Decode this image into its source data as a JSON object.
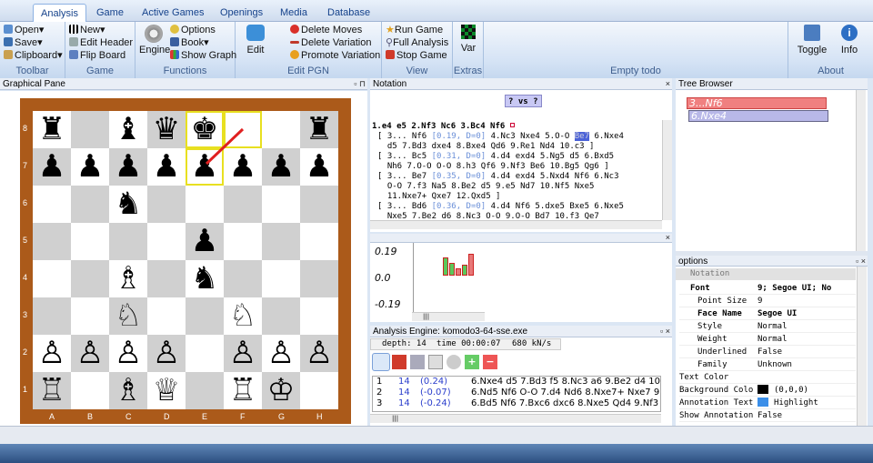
{
  "ribbon": {
    "tabs": [
      "Analysis",
      "Game",
      "Active Games",
      "Openings",
      "Media",
      "Database"
    ],
    "active_tab": "Analysis",
    "toolbar": {
      "open": "Open",
      "save": "Save",
      "clipboard": "Clipboard",
      "label": "Toolbar"
    },
    "game": {
      "new": "New",
      "edit_header": "Edit Header",
      "flip_board": "Flip Board",
      "label": "Game"
    },
    "functions": {
      "engine": "Engine",
      "options": "Options",
      "book": "Book",
      "show_graph": "Show Graph",
      "label": "Functions"
    },
    "edit_pgn": {
      "edit": "Edit",
      "delete_moves": "Delete Moves",
      "delete_variation": "Delete Variation",
      "promote_variation": "Promote Variation",
      "label": "Edit PGN"
    },
    "view": {
      "run_game": "Run Game",
      "full_analysis": "Full Analysis",
      "stop_game": "Stop Game",
      "label": "View"
    },
    "extras": {
      "var": "Var",
      "label": "Extras"
    },
    "empty": {
      "label": "Empty todo"
    },
    "about": {
      "toggle": "Toggle",
      "info": "Info",
      "label": "About"
    }
  },
  "graphical_pane": {
    "title": "Graphical Pane"
  },
  "board": {
    "files": [
      "A",
      "B",
      "C",
      "D",
      "E",
      "F",
      "G",
      "H"
    ],
    "ranks": [
      "8",
      "7",
      "6",
      "5",
      "4",
      "3",
      "2",
      "1"
    ],
    "rows": [
      [
        "♜",
        "",
        "♝",
        "♛",
        "♚",
        "",
        "",
        "♜"
      ],
      [
        "♟",
        "♟",
        "♟",
        "♟",
        "♟",
        "♟",
        "♟",
        "♟"
      ],
      [
        "",
        "",
        "♞",
        "",
        "",
        "",
        "",
        ""
      ],
      [
        "",
        "",
        "",
        "",
        "♟",
        "",
        "",
        ""
      ],
      [
        "",
        "",
        "♗",
        "",
        "♞",
        "",
        "",
        ""
      ],
      [
        "",
        "",
        "♘",
        "",
        "",
        "♘",
        "",
        ""
      ],
      [
        "♙",
        "♙",
        "♙",
        "♙",
        "",
        "♙",
        "♙",
        "♙"
      ],
      [
        "♖",
        "",
        "♗",
        "♕",
        "",
        "♖",
        "♔",
        ""
      ]
    ]
  },
  "notation": {
    "title": "Notation",
    "vs": "? vs ?",
    "main_line": "1.e4 e5 2.Nf3 Nc6 3.Bc4 Nf6",
    "lines": [
      {
        "pre": "[ 3... Nf6 ",
        "eval": "[0.19, D=0]",
        "post": " 4.Nc3 Nxe4 5.O-O ",
        "hl": "Be7",
        "tail": " 6.Nxe4"
      },
      {
        "pre": "  d5 7.Bd3 dxe4 8.Bxe4 Qd6 9.Re1 Nd4 10.c3 ]",
        "eval": "",
        "post": "",
        "hl": "",
        "tail": ""
      },
      {
        "pre": "[ 3... Bc5 ",
        "eval": "[0.31, D=0]",
        "post": " 4.d4 exd4 5.Ng5 d5 6.Bxd5",
        "hl": "",
        "tail": ""
      },
      {
        "pre": "  Nh6 7.O-O O-O 8.h3 Qf6 9.Nf3 Be6 10.Bg5 Qg6 ]",
        "eval": "",
        "post": "",
        "hl": "",
        "tail": ""
      },
      {
        "pre": "[ 3... Be7 ",
        "eval": "[0.35, D=0]",
        "post": " 4.d4 exd4 5.Nxd4 Nf6 6.Nc3",
        "hl": "",
        "tail": ""
      },
      {
        "pre": "  O-O 7.f3 Na5 8.Be2 d5 9.e5 Nd7 10.Nf5 Nxe5",
        "eval": "",
        "post": "",
        "hl": "",
        "tail": ""
      },
      {
        "pre": "  11.Nxe7+ Qxe7 12.Qxd5 ]",
        "eval": "",
        "post": "",
        "hl": "",
        "tail": ""
      },
      {
        "pre": "[ 3... Bd6 ",
        "eval": "[0.36, D=0]",
        "post": " 4.d4 Nf6 5.dxe5 Bxe5 6.Nxe5",
        "hl": "",
        "tail": ""
      },
      {
        "pre": "  Nxe5 7.Be2 d6 8.Nc3 O-O 9.O-O Bd7 10.f3 Qe7",
        "eval": "",
        "post": "",
        "hl": "",
        "tail": ""
      }
    ]
  },
  "graph": {
    "labels": [
      "0.19",
      "0.0",
      "-0.19"
    ]
  },
  "analysis": {
    "title": "Analysis Engine: komodo3-64-sse.exe",
    "depth": "depth:  14",
    "time": "time 00:00:07",
    "speed": "680 kN/s",
    "rows": [
      {
        "n": "1",
        "d": "14",
        "score": "(0.24)",
        "pv": "6.Nxe4 d5 7.Bd3 f5 8.Nc3 a6 9.Be2 d4 10.N"
      },
      {
        "n": "2",
        "d": "14",
        "score": "(-0.07)",
        "pv": "6.Nd5 Nf6 O-O 7.d4 Nd6 8.Nxe7+ Nxe7 9.Nxe5"
      },
      {
        "n": "3",
        "d": "14",
        "score": "(-0.24)",
        "pv": "6.Bd5 Nf6 7.Bxc6 dxc6 8.Nxe5 Qd4 9.Nf3 C"
      }
    ]
  },
  "tree": {
    "title": "Tree Browser",
    "nodes": [
      "3...Nf6",
      "6.Nxe4"
    ]
  },
  "options": {
    "title": "options",
    "section": "Notation",
    "font_key": "Font",
    "font_val": "9; Segoe UI; No",
    "rows": [
      {
        "k": "Point Size",
        "v": "9"
      },
      {
        "k": "Face Name",
        "v": "Segoe UI"
      },
      {
        "k": "Style",
        "v": "Normal"
      },
      {
        "k": "Weight",
        "v": "Normal"
      },
      {
        "k": "Underlined",
        "v": "False"
      },
      {
        "k": "Family",
        "v": "Unknown"
      }
    ],
    "text_color": "Text Color",
    "bg_key": "Background Colo",
    "bg_val": "(0,0,0)",
    "ann_key": "Annotation Text",
    "ann_val": "Highlight",
    "show_key": "Show Annotation",
    "show_val": "False"
  },
  "colors": {
    "accent": "#15428b",
    "highlight": "#ffff66",
    "arrow": "#e02020"
  }
}
